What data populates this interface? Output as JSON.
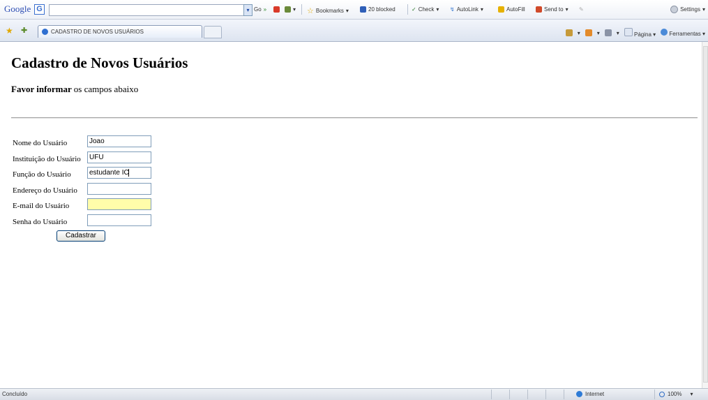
{
  "toolbar": {
    "google_logo": "Google",
    "g_button": "G",
    "go_label": "Go",
    "bookmarks": "Bookmarks",
    "blocked": "20 blocked",
    "check": "Check",
    "autolink": "AutoLink",
    "autofill": "AutoFill",
    "send_to": "Send to",
    "settings": "Settings"
  },
  "tabbar": {
    "tab_title": "CADASTRO DE NOVOS USUÁRIOS",
    "pagina": "Página",
    "ferramentas": "Ferramentas"
  },
  "page": {
    "title": "Cadastro de Novos Usuários",
    "subtitle_bold": "Favor informar",
    "subtitle_rest": "os campos abaixo"
  },
  "form": {
    "fields": [
      {
        "label": "Nome do Usuário",
        "value": "Joao"
      },
      {
        "label": "Instituição do Usuário",
        "value": "UFU"
      },
      {
        "label": "Função do Usuário",
        "value": "estudante IC"
      },
      {
        "label": "Endereço do Usuário",
        "value": ""
      },
      {
        "label": "E-mail do Usuário",
        "value": ""
      },
      {
        "label": "Senha do Usuário",
        "value": ""
      }
    ],
    "submit_label": "Cadastrar",
    "highlight_color": "#fffdaa"
  },
  "status": {
    "text": "Concluído",
    "zone": "Internet",
    "zoom": "100%"
  }
}
